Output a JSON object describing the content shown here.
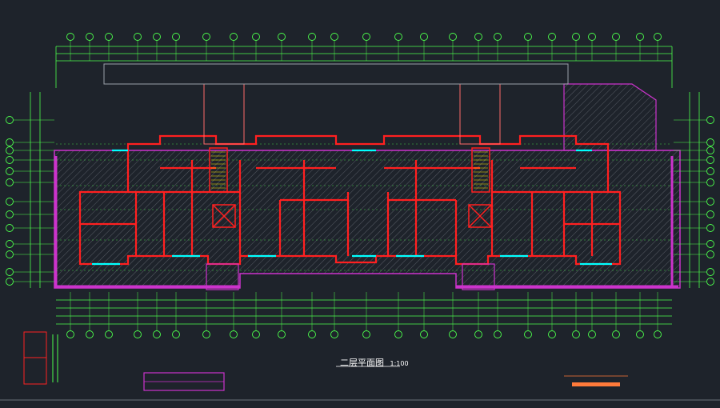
{
  "title": {
    "main": "二层平面图",
    "scale": "1:100"
  },
  "colors": {
    "background": "#1e232b",
    "grid_lines": "#4cff4c",
    "walls": "#ff2020",
    "hatch_area": "#cc33cc",
    "windows": "#00ffff",
    "text": "#ffffff",
    "yellow_text": "#ffe600"
  }
}
